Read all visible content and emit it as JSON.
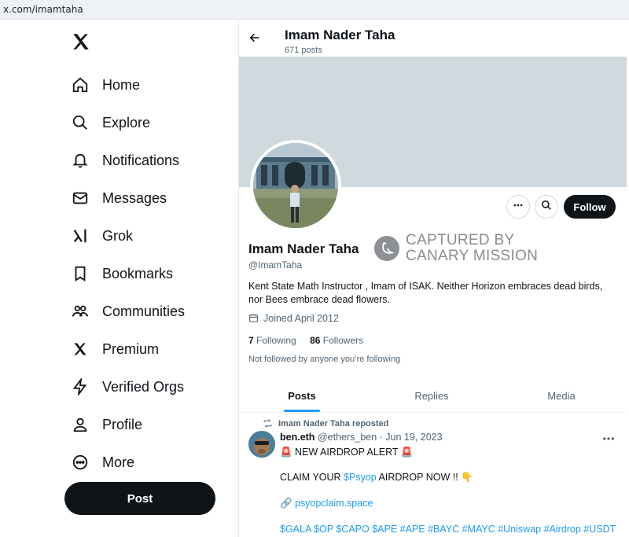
{
  "browser": {
    "url": "x.com/imamtaha"
  },
  "sidebar": {
    "items": [
      {
        "label": "Home",
        "icon": "home-icon"
      },
      {
        "label": "Explore",
        "icon": "search-icon"
      },
      {
        "label": "Notifications",
        "icon": "bell-icon"
      },
      {
        "label": "Messages",
        "icon": "mail-icon"
      },
      {
        "label": "Grok",
        "icon": "grok-icon"
      },
      {
        "label": "Bookmarks",
        "icon": "bookmark-icon"
      },
      {
        "label": "Communities",
        "icon": "communities-icon"
      },
      {
        "label": "Premium",
        "icon": "x-logo-icon"
      },
      {
        "label": "Verified Orgs",
        "icon": "lightning-icon"
      },
      {
        "label": "Profile",
        "icon": "person-icon"
      },
      {
        "label": "More",
        "icon": "more-circle-icon"
      }
    ],
    "post_label": "Post"
  },
  "header": {
    "title": "Imam Nader Taha",
    "post_count": "671 posts"
  },
  "profile": {
    "name": "Imam Nader Taha",
    "handle": "@ImamTaha",
    "bio": "Kent State Math Instructor , Imam of ISAK. Neither Horizon embraces dead birds, nor Bees embrace dead flowers.",
    "joined": "Joined April 2012",
    "following_count": "7",
    "following_label": "Following",
    "followers_count": "86",
    "followers_label": "Followers",
    "not_followed": "Not followed by anyone you’re following",
    "follow_label": "Follow"
  },
  "watermark": {
    "line1": "CAPTURED BY",
    "line2": "CANARY MISSION"
  },
  "tabs": [
    {
      "label": "Posts",
      "active": true
    },
    {
      "label": "Replies",
      "active": false
    },
    {
      "label": "Media",
      "active": false
    }
  ],
  "tweet": {
    "repost_label": "Imam Nader Taha reposted",
    "author_name": "ben.eth",
    "author_handle": "@ethers_ben",
    "separator": " · ",
    "date": "Jun 19, 2023",
    "line1": "🚨 NEW AIRDROP ALERT 🚨",
    "line2_pre": "CLAIM YOUR ",
    "line2_link": "$Psyop",
    "line2_post": " AIRDROP NOW !! 👇",
    "link_icon": "🔗",
    "link_text": "psyopclaim.space",
    "tags": "$GALA $OP $CAPO $APE #APE #BAYC #MAYC #Uniswap #Airdrop #USDT"
  },
  "colors": {
    "accent": "#1d9bf0",
    "text": "#0f1419",
    "muted": "#536471",
    "banner": "#cfd9de"
  }
}
